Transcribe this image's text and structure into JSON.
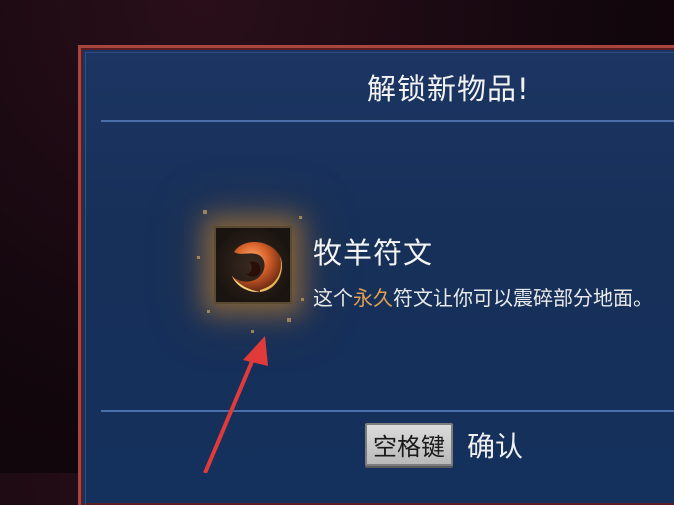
{
  "dialog": {
    "title": "解锁新物品!",
    "item": {
      "icon": "ram-rune-icon",
      "name": "牧羊符文",
      "description_prefix": "这个",
      "description_highlight": "永久",
      "description_suffix": "符文让你可以震碎部分地面。"
    },
    "confirm": {
      "key_label": "空格键",
      "action_label": "确认"
    }
  },
  "colors": {
    "panel": "#163059",
    "border": "#a8453f",
    "highlight_text": "#e0a050",
    "annotation_arrow": "#e03a3a"
  }
}
